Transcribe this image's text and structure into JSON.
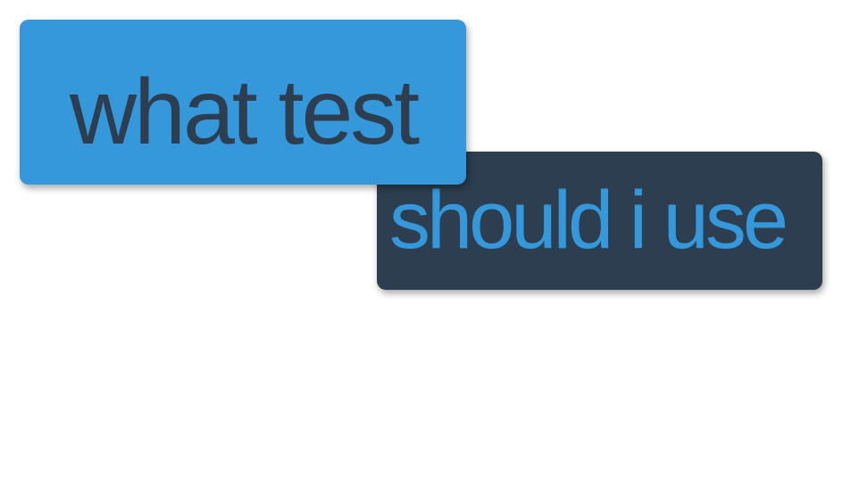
{
  "slide": {
    "line1": "what test",
    "line2": "should i use"
  },
  "colors": {
    "blue": "#3498db",
    "dark": "#2c3e50",
    "background": "#ffffff"
  }
}
